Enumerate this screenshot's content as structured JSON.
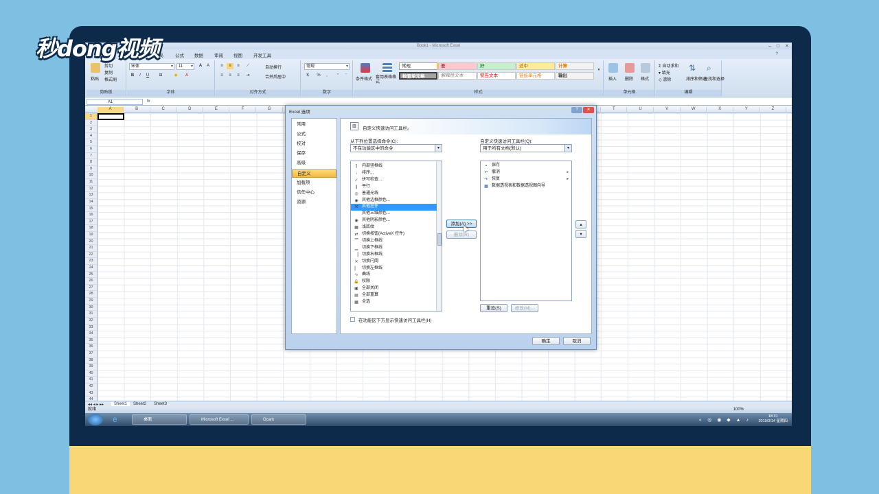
{
  "logo": "秒dong视频",
  "window": {
    "title": "Book1 - Microsoft Excel"
  },
  "ribbon_tabs": [
    "布局",
    "公式",
    "数据",
    "审阅",
    "视图",
    "开发工具"
  ],
  "clipboard": {
    "paste": "粘贴",
    "cut": "剪切",
    "copy": "复制",
    "format_painter": "格式刷",
    "label": "剪贴板"
  },
  "font": {
    "name": "宋体",
    "size": "11",
    "label": "字体"
  },
  "alignment": {
    "wrap": "自动换行",
    "merge": "合并后居中",
    "label": "对齐方式"
  },
  "number": {
    "format": "常规",
    "label": "数字"
  },
  "styles": {
    "cond_format": "条件格式",
    "table_format": "套用表格格式",
    "label": "样式",
    "cells": [
      "常规",
      "差",
      "好",
      "适中",
      "计算",
      "检查单元格",
      "解释性文本",
      "警告文本",
      "链接单元格",
      "输出"
    ]
  },
  "cells_group": {
    "insert": "插入",
    "delete": "删除",
    "format": "格式",
    "label": "单元格"
  },
  "editing": {
    "autosum": "自动求和",
    "fill": "填充",
    "clear": "清除",
    "sort": "排序和筛选",
    "find": "查找和选择",
    "label": "编辑"
  },
  "formula_bar": {
    "name_box": "A1",
    "fx": "fx"
  },
  "columns": [
    "A",
    "B",
    "C",
    "D",
    "E",
    "F",
    "G",
    "H",
    "I",
    "J",
    "K",
    "L",
    "M",
    "N",
    "O",
    "P",
    "Q",
    "R",
    "S",
    "T",
    "U",
    "V",
    "W",
    "X",
    "Y",
    "Z"
  ],
  "rows": [
    "1",
    "2",
    "3",
    "4",
    "5",
    "6",
    "7",
    "8",
    "9",
    "10",
    "11",
    "12",
    "13",
    "14",
    "15",
    "16",
    "17",
    "18",
    "19",
    "20",
    "21",
    "22",
    "23",
    "24",
    "25",
    "26",
    "27",
    "28",
    "29",
    "30",
    "31",
    "32",
    "33",
    "34",
    "35",
    "36",
    "37",
    "38",
    "39",
    "40",
    "41",
    "42",
    "43",
    "44"
  ],
  "sheets": [
    "Sheet1",
    "Sheet2",
    "Sheet3"
  ],
  "status": {
    "ready": "就绪",
    "zoom": "100%"
  },
  "taskbar": {
    "items": [
      "桌面",
      "Microsoft Excel ...",
      "Ocam"
    ],
    "time": "18:31",
    "date": "2019/3/14 星期四"
  },
  "dialog": {
    "title": "Excel 选项",
    "nav": [
      "常用",
      "公式",
      "校对",
      "保存",
      "高级",
      "自定义",
      "加载项",
      "信任中心",
      "资源"
    ],
    "nav_active": "自定义",
    "header": "自定义快速访问工具栏。",
    "choose_label": "从下列位置选择命令(C):",
    "choose_value": "不在功能区中的命令",
    "customize_label": "自定义快速访问工具栏(Q):",
    "customize_value": "用于所有文档(默认)",
    "commands": [
      {
        "label": "内部竖框线",
        "icon": "⫿"
      },
      {
        "label": "排序...",
        "icon": "↓"
      },
      {
        "label": "拼写检查...",
        "icon": "✓"
      },
      {
        "label": "平行",
        "icon": "∥"
      },
      {
        "label": "普通光线",
        "icon": "◎"
      },
      {
        "label": "其他边框颜色...",
        "icon": "◉"
      },
      {
        "label": "其他控件",
        "icon": "⚒"
      },
      {
        "label": "其他三维颜色...",
        "icon": ""
      },
      {
        "label": "其他阴影颜色...",
        "icon": "◉"
      },
      {
        "label": "浅底纹",
        "icon": "▦"
      },
      {
        "label": "切换按钮(ActiveX 控件)",
        "icon": "⇄"
      },
      {
        "label": "切换上框线",
        "icon": "▔"
      },
      {
        "label": "切换下框线",
        "icon": "▁"
      },
      {
        "label": "切换右框线",
        "icon": "▕"
      },
      {
        "label": "切换闩阈",
        "icon": "✕"
      },
      {
        "label": "切换左框线",
        "icon": "▏"
      },
      {
        "label": "曲线",
        "icon": "∿"
      },
      {
        "label": "权限",
        "icon": "🔒"
      },
      {
        "label": "全部关闭",
        "icon": "▣"
      },
      {
        "label": "全部重算",
        "icon": "▤"
      },
      {
        "label": "全选",
        "icon": "▦"
      }
    ],
    "selected_command": "其他控件",
    "toolbar_items": [
      {
        "label": "保存",
        "icon": "▪"
      },
      {
        "label": "撤消",
        "icon": "↶",
        "sub": "▸"
      },
      {
        "label": "恢复",
        "icon": "↷",
        "sub": "▸"
      },
      {
        "label": "数据透视表和数据透视图向导",
        "icon": "▦"
      }
    ],
    "add_button": "添加(A) >>",
    "remove_button": "删除(R)",
    "reset_button": "重设(S)",
    "modify_button": "修改(M)...",
    "show_below_label": "在功能区下方显示快速访问工具栏(H)",
    "ok_button": "确定",
    "cancel_button": "取消"
  }
}
